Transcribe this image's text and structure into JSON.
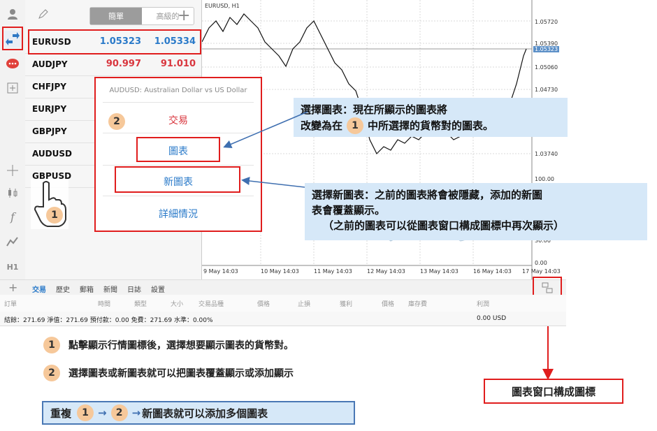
{
  "segment": {
    "simple": "簡單",
    "advanced": "高級的"
  },
  "quotes": [
    {
      "symbol": "EURUSD",
      "bid": "1.05323",
      "ask": "1.05334",
      "color": "blue"
    },
    {
      "symbol": "AUDJPY",
      "bid": "90.997",
      "ask": "91.010",
      "color": "red"
    },
    {
      "symbol": "CHFJPY",
      "bid": "",
      "ask": "",
      "color": "blue"
    },
    {
      "symbol": "EURJPY",
      "bid": "",
      "ask": "",
      "color": "blue"
    },
    {
      "symbol": "GBPJPY",
      "bid": "",
      "ask": "",
      "color": "blue"
    },
    {
      "symbol": "AUDUSD",
      "bid": "",
      "ask": "",
      "color": "blue"
    },
    {
      "symbol": "GBPUSD",
      "bid": "",
      "ask": "",
      "color": "blue"
    }
  ],
  "toolbar": {
    "timeframe": "H1"
  },
  "chart": {
    "title": "EURUSD, H1",
    "price_labels": [
      "1.05720",
      "1.05390",
      "1.05323",
      "1.05060",
      "1.04730",
      "1.03740",
      "100.00",
      "30.00",
      "0.00"
    ],
    "date_labels": [
      "9 May 14:03",
      "10 May 14:03",
      "11 May 14:03",
      "12 May 14:03",
      "13 May 14:03",
      "16 May 14:03",
      "17 May 14:03"
    ]
  },
  "popup": {
    "title": "AUDUSD: Australian Dollar vs US Dollar",
    "trade": "交易",
    "chart": "圖表",
    "new_chart": "新圖表",
    "details": "詳細情況"
  },
  "callouts": {
    "chart_line1": "選擇圖表：現在所顯示的圖表將",
    "chart_line2a": "改變為在",
    "chart_line2b": "中所選擇的貨幣對的圖表。",
    "new_line1": "選擇新圖表：之前的圖表將會被隱藏，添加的新圖",
    "new_line2": "表會覆蓋顯示。",
    "new_line3": "（之前的圖表可以從圖表窗口構成圖標中再次顯示）"
  },
  "tabs": [
    "交易",
    "歷史",
    "郵箱",
    "新聞",
    "日誌",
    "設置"
  ],
  "columns": [
    "訂單",
    "時間",
    "類型",
    "大小",
    "交易品種",
    "價格",
    "止損",
    "獲利",
    "價格",
    "庫存費",
    "利潤"
  ],
  "status": {
    "summary": "結餘：271.69 淨值：271.69 預付款：0.00 免費：271.69 水準：0.00%",
    "profit": "0.00 USD"
  },
  "notes": {
    "n1": "點擊顯示行情圖標後，選擇想要顯示圖表的貨幣對。",
    "n2": "選擇圖表或新圖表就可以把圖表覆蓋顯示或添加顯示",
    "repeat_prefix": "重複",
    "repeat_suffix": "新圖表就可以添加多個圖表"
  },
  "chart_window_label": "圖表窗口構成圖標",
  "numbers": {
    "one": "1",
    "two": "2"
  }
}
